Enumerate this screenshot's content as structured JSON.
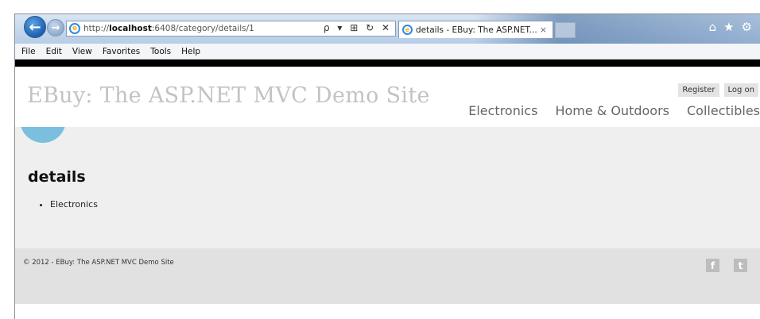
{
  "browser": {
    "address": {
      "prefix": "http://",
      "host": "localhost",
      "path": ":6408/category/details/1",
      "tools": "ρ ▾ ⊞ ↻ ✕"
    },
    "tab_title": "details - EBuy: The ASP.NET...",
    "tab_close": "×",
    "menu": [
      "File",
      "Edit",
      "View",
      "Favorites",
      "Tools",
      "Help"
    ],
    "icons": [
      "home-icon",
      "star-icon",
      "gear-icon"
    ]
  },
  "site": {
    "title": "EBuy: The ASP.NET MVC Demo Site",
    "auth": {
      "register": "Register",
      "logon": "Log on"
    },
    "nav": [
      "Electronics",
      "Home & Outdoors",
      "Collectibles"
    ]
  },
  "main": {
    "heading": "details",
    "items": [
      "Electronics"
    ]
  },
  "footer": {
    "copyright": "© 2012 - EBuy: The ASP.NET MVC Demo Site",
    "social": {
      "facebook": "f",
      "twitter": "t"
    }
  },
  "colors": {
    "accent_circle": "#7ac0de",
    "title_gray": "#c3c3c3",
    "content_bg": "#efefef",
    "footer_bg": "#e1e1e1"
  }
}
